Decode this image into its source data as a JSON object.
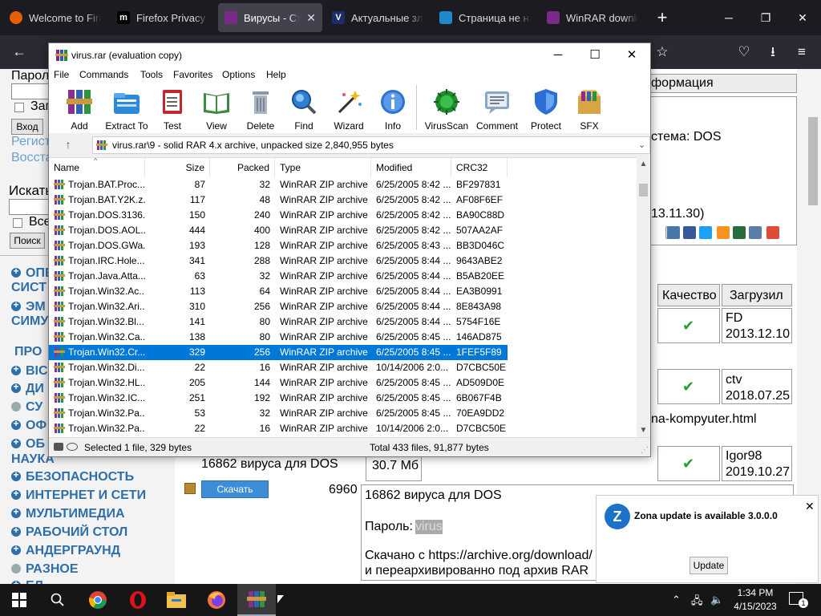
{
  "browser": {
    "tabs": [
      {
        "title": "Welcome to Firefox",
        "icon": "firefox-icon",
        "color": "#e66000"
      },
      {
        "title": "Firefox Privacy Notice",
        "icon": "mozilla-icon",
        "color": "#000000"
      },
      {
        "title": "Вирусы - Старые",
        "icon": "winrar-icon",
        "color": "#7a2b8a"
      },
      {
        "title": "Актуальные зловреды",
        "icon": "v-icon",
        "color": "#1d2c6b"
      },
      {
        "title": "Страница не найдена",
        "icon": "chart-icon",
        "color": "#1e88c9"
      },
      {
        "title": "WinRAR download",
        "icon": "winrar-icon",
        "color": "#7a2b8a"
      }
    ]
  },
  "webpage": {
    "login": {
      "password_label": "Пароль",
      "remember_label": "Зап",
      "login_button": "Вход",
      "register_link": "Регист",
      "restore_link": "Восста",
      "search_label": "Искать",
      "all_label": "Все",
      "search_button": "Поиск"
    },
    "categories": [
      {
        "label": "ОПЕ"
      },
      {
        "label": "СИСТ"
      },
      {
        "label": "ЭМ"
      },
      {
        "label": "СИМУ"
      },
      {
        "label": "ПРО"
      },
      {
        "label": "ВІС"
      },
      {
        "label": "ДИ"
      },
      {
        "label": "СУ"
      },
      {
        "label": "ОФ"
      },
      {
        "label": "ОБ"
      },
      {
        "label": "НАУКА"
      },
      {
        "label": "БЕЗОПАСНОСТЬ"
      },
      {
        "label": "ИНТЕРНЕТ И СЕТИ"
      },
      {
        "label": "МУЛЬТИМЕДИА"
      },
      {
        "label": "РАБОЧИЙ СТОЛ"
      },
      {
        "label": "АНДЕРГРАУНД"
      },
      {
        "label": "РАЗНОЕ"
      },
      {
        "label": "ЕЛ"
      }
    ],
    "right": {
      "info_header": "формация",
      "system_text": "стема: DOS",
      "date_text": "13.11.30)",
      "col_quality": "Качество",
      "col_uploaded": "Загрузил",
      "uploads": [
        {
          "user": "FD",
          "date": "2013.12.10"
        },
        {
          "user": "ctv",
          "date": "2018.07.25"
        },
        {
          "user": "Igor98",
          "date": "2019.10.27"
        }
      ],
      "link_text": "na-kompyuter.html",
      "size_text": "30.7 Мб",
      "file_title": "16862 вируса для DOS",
      "download_label": "Скачать",
      "downloads_count": "6960",
      "desc_title": "16862 вируса для DOS",
      "password_label": "Пароль:",
      "password_value": "virus",
      "source_line1": "Скачано с https://archive.org/download/",
      "source_line2": "и переархивированно под архив RAR"
    }
  },
  "winrar": {
    "title": "virus.rar (evaluation copy)",
    "menu": [
      "File",
      "Commands",
      "Tools",
      "Favorites",
      "Options",
      "Help"
    ],
    "toolbar": [
      {
        "label": "Add",
        "icon": "add-icon"
      },
      {
        "label": "Extract To",
        "icon": "extract-icon"
      },
      {
        "label": "Test",
        "icon": "test-icon"
      },
      {
        "label": "View",
        "icon": "view-icon"
      },
      {
        "label": "Delete",
        "icon": "delete-icon"
      },
      {
        "label": "Find",
        "icon": "find-icon"
      },
      {
        "label": "Wizard",
        "icon": "wizard-icon"
      },
      {
        "label": "Info",
        "icon": "info-icon"
      },
      {
        "label": "VirusScan",
        "icon": "virusscan-icon"
      },
      {
        "label": "Comment",
        "icon": "comment-icon"
      },
      {
        "label": "Protect",
        "icon": "protect-icon"
      },
      {
        "label": "SFX",
        "icon": "sfx-icon"
      }
    ],
    "path": "virus.rar\\9 - solid RAR 4.x archive, unpacked size 2,840,955 bytes",
    "columns": [
      "Name",
      "Size",
      "Packed",
      "Type",
      "Modified",
      "CRC32"
    ],
    "rows": [
      {
        "name": "Trojan.BAT.Proc...",
        "size": "87",
        "packed": "32",
        "type": "WinRAR ZIP archive",
        "modified": "6/25/2005 8:42 ...",
        "crc": "BF297831"
      },
      {
        "name": "Trojan.BAT.Y2K.z...",
        "size": "117",
        "packed": "48",
        "type": "WinRAR ZIP archive",
        "modified": "6/25/2005 8:42 ...",
        "crc": "AF08F6EF"
      },
      {
        "name": "Trojan.DOS.3136...",
        "size": "150",
        "packed": "240",
        "type": "WinRAR ZIP archive",
        "modified": "6/25/2005 8:42 ...",
        "crc": "BA90C88D"
      },
      {
        "name": "Trojan.DOS.AOL...",
        "size": "444",
        "packed": "400",
        "type": "WinRAR ZIP archive",
        "modified": "6/25/2005 8:42 ...",
        "crc": "507AA2AF"
      },
      {
        "name": "Trojan.DOS.GWa...",
        "size": "193",
        "packed": "128",
        "type": "WinRAR ZIP archive",
        "modified": "6/25/2005 8:43 ...",
        "crc": "BB3D046C"
      },
      {
        "name": "Trojan.IRC.Hole....",
        "size": "341",
        "packed": "288",
        "type": "WinRAR ZIP archive",
        "modified": "6/25/2005 8:44 ...",
        "crc": "9643ABE2"
      },
      {
        "name": "Trojan.Java.Atta...",
        "size": "63",
        "packed": "32",
        "type": "WinRAR ZIP archive",
        "modified": "6/25/2005 8:44 ...",
        "crc": "B5AB20EE"
      },
      {
        "name": "Trojan.Win32.Ac...",
        "size": "113",
        "packed": "64",
        "type": "WinRAR ZIP archive",
        "modified": "6/25/2005 8:44 ...",
        "crc": "EA3B0991"
      },
      {
        "name": "Trojan.Win32.Ari...",
        "size": "310",
        "packed": "256",
        "type": "WinRAR ZIP archive",
        "modified": "6/25/2005 8:44 ...",
        "crc": "8E843A98"
      },
      {
        "name": "Trojan.Win32.Bl...",
        "size": "141",
        "packed": "80",
        "type": "WinRAR ZIP archive",
        "modified": "6/25/2005 8:44 ...",
        "crc": "5754F16E"
      },
      {
        "name": "Trojan.Win32.Ca...",
        "size": "138",
        "packed": "80",
        "type": "WinRAR ZIP archive",
        "modified": "6/25/2005 8:45 ...",
        "crc": "146AD875"
      },
      {
        "name": "Trojan.Win32.Cr...",
        "size": "329",
        "packed": "256",
        "type": "WinRAR ZIP archive",
        "modified": "6/25/2005 8:45 ...",
        "crc": "1FEF5F89",
        "selected": true
      },
      {
        "name": "Trojan.Win32.Di...",
        "size": "22",
        "packed": "16",
        "type": "WinRAR ZIP archive",
        "modified": "10/14/2006 2:0...",
        "crc": "D7CBC50E"
      },
      {
        "name": "Trojan.Win32.HL...",
        "size": "205",
        "packed": "144",
        "type": "WinRAR ZIP archive",
        "modified": "6/25/2005 8:45 ...",
        "crc": "AD509D0E"
      },
      {
        "name": "Trojan.Win32.IC...",
        "size": "251",
        "packed": "192",
        "type": "WinRAR ZIP archive",
        "modified": "6/25/2005 8:45 ...",
        "crc": "6B067F4B"
      },
      {
        "name": "Trojan.Win32.Pa...",
        "size": "53",
        "packed": "32",
        "type": "WinRAR ZIP archive",
        "modified": "6/25/2005 8:45 ...",
        "crc": "70EA9DD2"
      },
      {
        "name": "Trojan.Win32.Pa...",
        "size": "22",
        "packed": "16",
        "type": "WinRAR ZIP archive",
        "modified": "10/14/2006 2:0...",
        "crc": "D7CBC50E"
      }
    ],
    "status_left": "Selected 1 file, 329 bytes",
    "status_right": "Total 433 files, 91,877 bytes"
  },
  "notification": {
    "message": "Zona update is available 3.0.0.0",
    "button": "Update"
  },
  "taskbar": {
    "apps": [
      "windows-start-icon",
      "search-icon",
      "chrome-icon",
      "opera-icon",
      "file-explorer-icon",
      "firefox-icon",
      "winrar-icon"
    ],
    "time": "1:34 PM",
    "date": "4/15/2023",
    "notification_count": "1"
  },
  "colors": {
    "selection": "#0078d7",
    "browser_bg": "#1c1b22",
    "link_blue": "#2e6fa8",
    "taskbar": "#161616"
  }
}
